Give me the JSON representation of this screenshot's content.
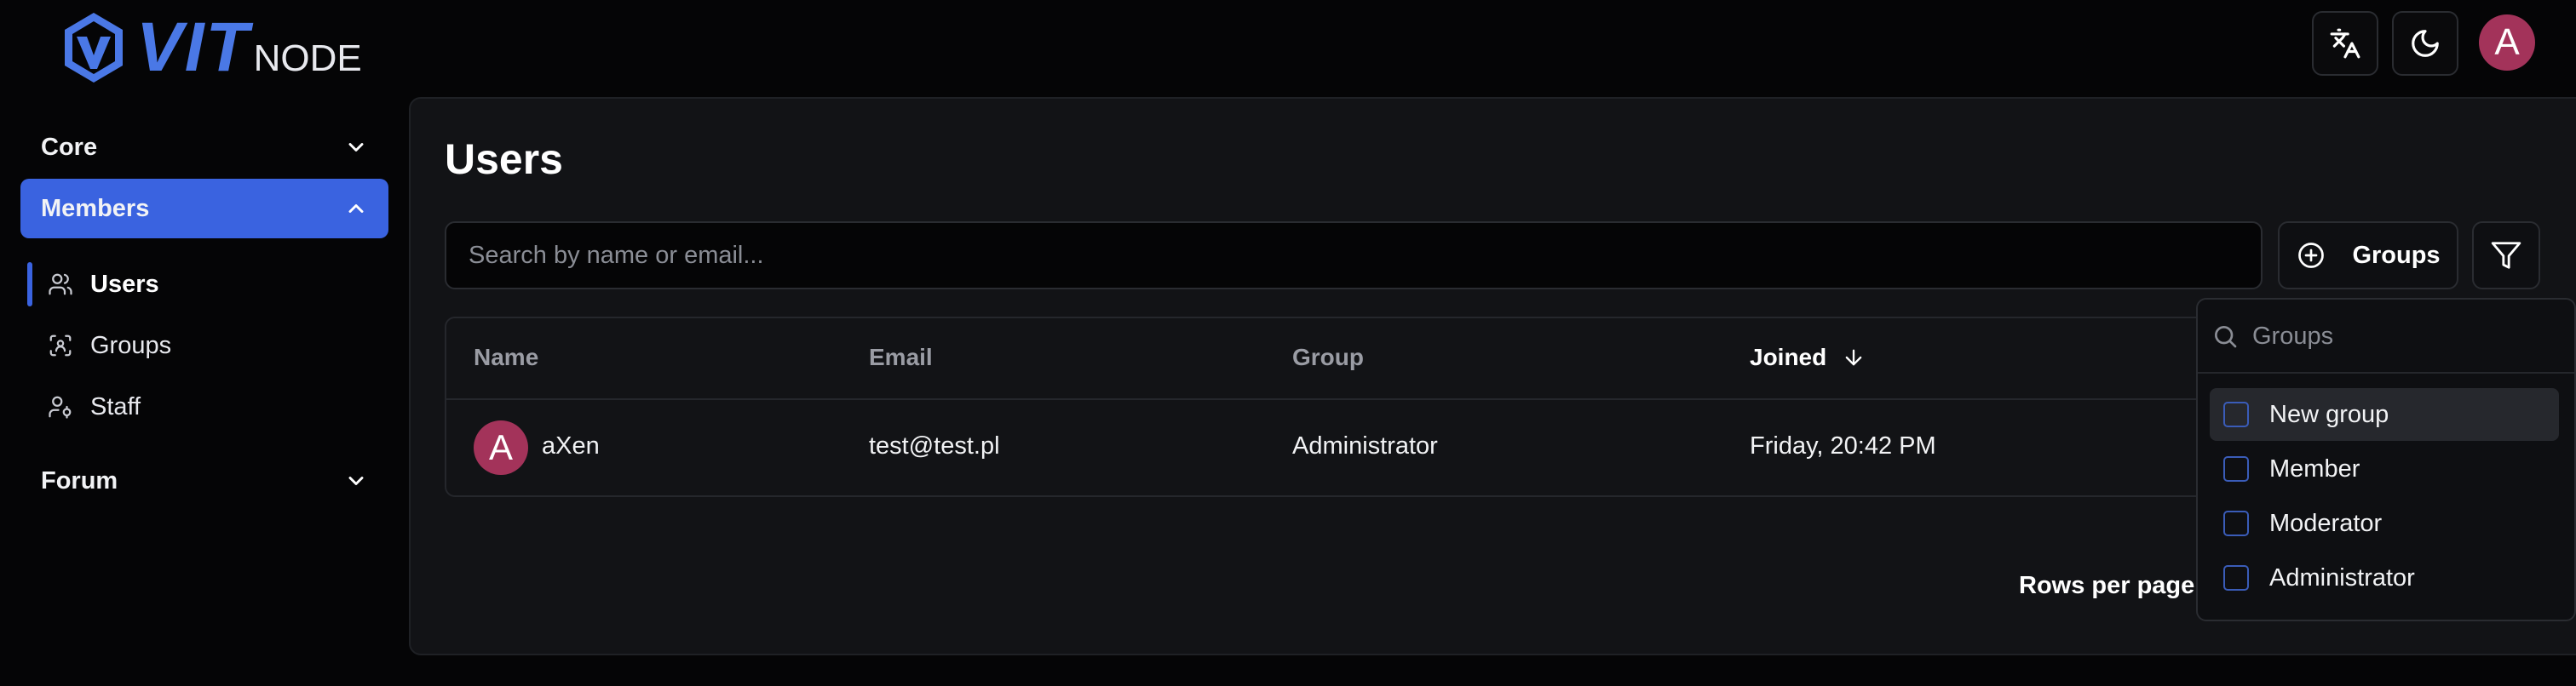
{
  "header": {
    "logo_main": "VIT",
    "logo_sub": "NODE",
    "translate_icon": "translate-icon",
    "theme_icon": "moon-icon",
    "avatar_letter": "A",
    "brand_color": "#4a78e6",
    "avatar_color": "#a3335a"
  },
  "sidebar": {
    "sections": [
      {
        "label": "Core",
        "expanded": false
      },
      {
        "label": "Members",
        "expanded": true
      },
      {
        "label": "Forum",
        "expanded": false
      }
    ],
    "members_items": [
      {
        "label": "Users",
        "icon": "users-icon",
        "active": true
      },
      {
        "label": "Groups",
        "icon": "groups-icon",
        "active": false
      },
      {
        "label": "Staff",
        "icon": "staff-icon",
        "active": false
      }
    ],
    "accent": "#3a63e0"
  },
  "main": {
    "title": "Users",
    "search_placeholder": "Search by name or email...",
    "groups_button": "Groups",
    "filter_icon": "filter-icon"
  },
  "table": {
    "headers": [
      "Name",
      "Email",
      "Group",
      "Joined"
    ],
    "sorted_column": "Joined",
    "sort_direction": "descending",
    "rows": [
      {
        "avatar_letter": "A",
        "name": "aXen",
        "email": "test@test.pl",
        "group": "Administrator",
        "joined": "Friday, 20:42 PM"
      }
    ],
    "rows_per_page_label": "Rows per page"
  },
  "groups_dropdown": {
    "search_placeholder": "Groups",
    "options": [
      {
        "label": "New group",
        "checked": false
      },
      {
        "label": "Member",
        "checked": false
      },
      {
        "label": "Moderator",
        "checked": false
      },
      {
        "label": "Administrator",
        "checked": false
      }
    ]
  }
}
